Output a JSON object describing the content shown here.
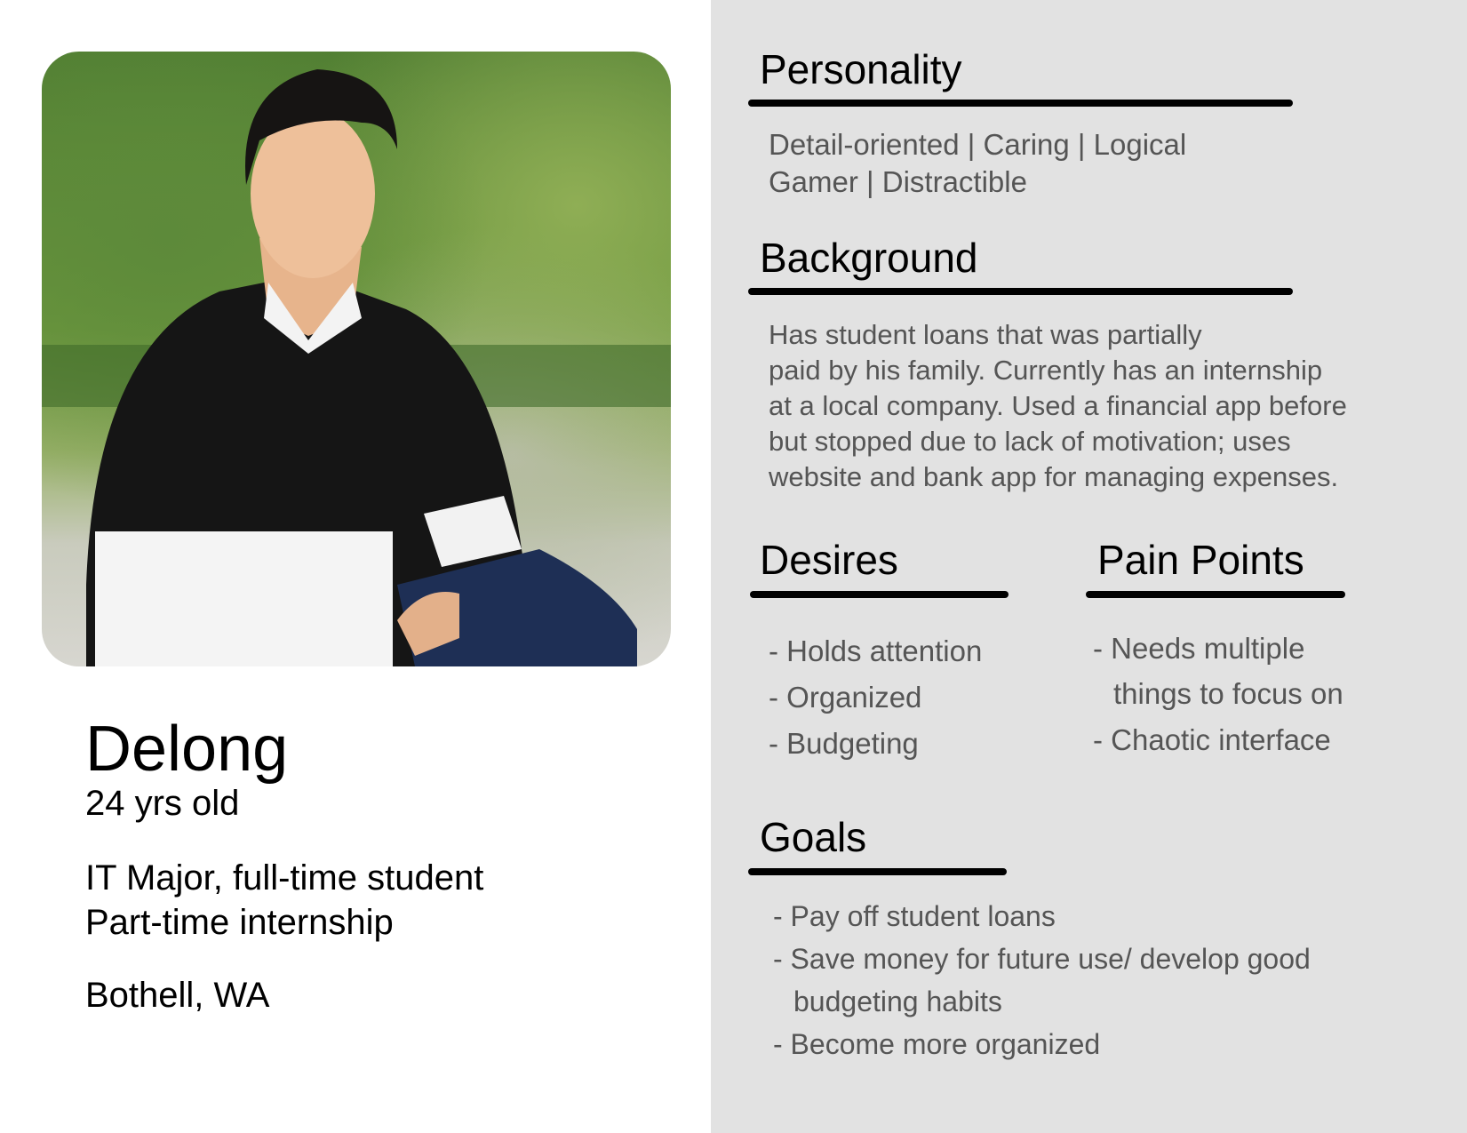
{
  "persona": {
    "name": "Delong",
    "age": "24 yrs old",
    "occupation_lines": [
      "IT Major, full-time student",
      "Part-time internship"
    ],
    "location": "Bothell, WA"
  },
  "personality": {
    "heading": "Personality",
    "lines": [
      "Detail-oriented | Caring | Logical",
      "Gamer | Distractible"
    ]
  },
  "background": {
    "heading": "Background",
    "lines": [
      "Has student loans that was partially",
      "paid by his family. Currently has an internship",
      "at a local company. Used a financial app before",
      "but stopped due to lack of motivation; uses",
      "website and bank app for managing expenses."
    ]
  },
  "desires": {
    "heading": "Desires",
    "items": [
      "- Holds attention",
      "- Organized",
      "- Budgeting"
    ]
  },
  "pain_points": {
    "heading": "Pain Points",
    "items": [
      "- Needs multiple",
      "things to focus on",
      "- Chaotic interface"
    ]
  },
  "goals": {
    "heading": "Goals",
    "items": [
      "- Pay off student loans",
      "- Save money for future use/ develop good",
      "budgeting habits",
      "- Become more organized"
    ]
  }
}
